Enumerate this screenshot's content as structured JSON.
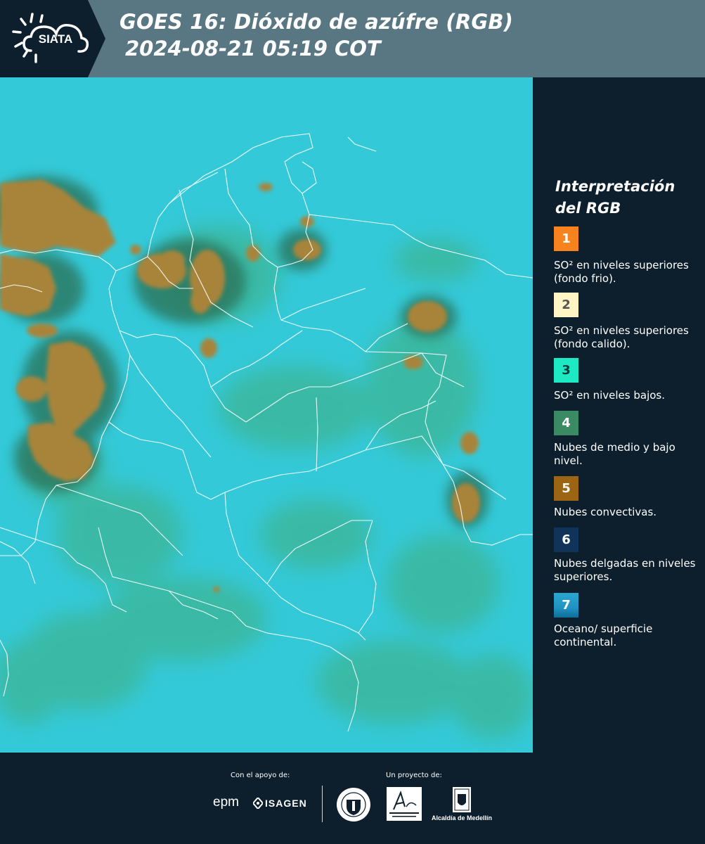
{
  "header": {
    "logo_text": "SIATA",
    "title_line1": "GOES 16: Dióxido de azúfre (RGB)",
    "title_line2": "2024-08-21 05:19 COT"
  },
  "legend": {
    "title": "Interpretación del RGB",
    "items": [
      {
        "number": "1",
        "label": "SO² en niveles superiores (fondo frio).",
        "color": "#f7831f",
        "text_color": "#ffffff"
      },
      {
        "number": "2",
        "label": "SO² en niveles superiores (fondo calido).",
        "color": "#fff5c4",
        "text_color": "#555555"
      },
      {
        "number": "3",
        "label": "SO² en niveles bajos.",
        "color": "#1de9c2",
        "text_color": "#0d3b3b"
      },
      {
        "number": "4",
        "label": "Nubes de medio y bajo nivel.",
        "color": "#3a8a63",
        "text_color": "#ffffff"
      },
      {
        "number": "5",
        "label": "Nubes convectivas.",
        "color": "#9b6514",
        "text_color": "#ffffff"
      },
      {
        "number": "6",
        "label": "Nubes delgadas en niveles superiores.",
        "color": "#10335a",
        "text_color": "#ffffff"
      },
      {
        "number": "7",
        "label": "Oceano/ superficie continental.",
        "color": "#1f93c4",
        "text_color": "#ffffff"
      }
    ]
  },
  "footer": {
    "support_label": "Con el apoyo de:",
    "project_label": "Un proyecto de:",
    "sponsors": [
      "epm",
      "ISAGEN"
    ],
    "partners": [
      "Área Metropolitana Valle de Aburrá",
      "Alcaldía de Medellín"
    ]
  },
  "colors": {
    "header_bg": "#587783",
    "logo_bg": "#0d1f2d",
    "panel_bg": "#0d1f2d",
    "map_ocean": "#34c9d8",
    "convective": "#a8843a",
    "mid_low_clouds": "#3fae7e"
  }
}
